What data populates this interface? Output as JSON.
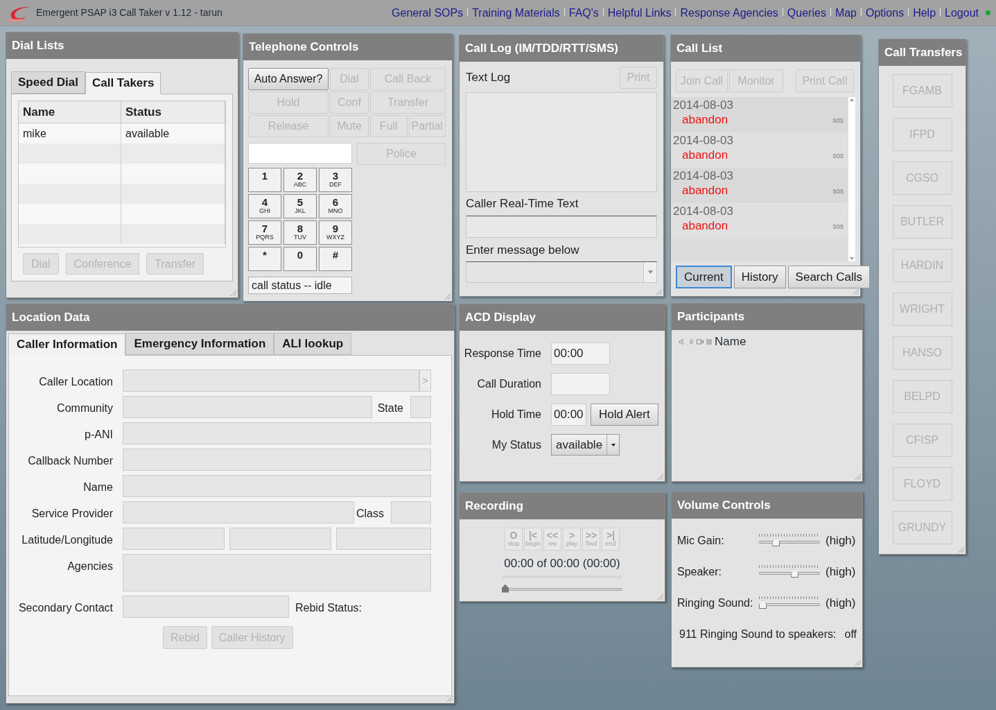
{
  "top_bar": {
    "title": "Emergent PSAP i3 Call Taker v 1.12 - tarun",
    "links": [
      "General SOPs",
      "Training Materials",
      "FAQ's",
      "Helpful Links",
      "Response Agencies",
      "Queries",
      "Map",
      "Options",
      "Help",
      "Logout"
    ],
    "connected": true
  },
  "dial_lists": {
    "title": "Dial Lists",
    "tabs": [
      {
        "label": "Speed Dial",
        "selected": false
      },
      {
        "label": "Call Takers",
        "selected": true
      }
    ],
    "columns": [
      "Name",
      "Status"
    ],
    "rows": [
      [
        "mike",
        "available"
      ]
    ],
    "buttons": [
      {
        "label": "Dial",
        "disabled": true
      },
      {
        "label": "Conference",
        "disabled": true
      },
      {
        "label": "Transfer",
        "disabled": true
      }
    ]
  },
  "telephone_controls": {
    "title": "Telephone Controls",
    "button_rows": [
      [
        {
          "label": "Auto Answer?",
          "disabled": false
        },
        {
          "label": "Dial",
          "disabled": true
        },
        {
          "label": "Call Back",
          "disabled": true
        }
      ],
      [
        {
          "label": "Hold",
          "disabled": true
        },
        {
          "label": "Conf",
          "disabled": true
        },
        {
          "label": "Transfer",
          "disabled": true
        }
      ],
      [
        {
          "label": "Release",
          "disabled": true
        },
        {
          "label": "Mute",
          "disabled": true
        },
        {
          "label": "Full",
          "disabled": true
        },
        {
          "label": "Partial",
          "disabled": true
        }
      ]
    ],
    "police_button": {
      "label": "Police",
      "disabled": true
    },
    "keypad": [
      {
        "digit": "1"
      },
      {
        "digit": "2",
        "letters": "ABC"
      },
      {
        "digit": "3",
        "letters": "DEF"
      },
      {
        "digit": "4",
        "letters": "GHI"
      },
      {
        "digit": "5",
        "letters": "JKL"
      },
      {
        "digit": "6",
        "letters": "MNO"
      },
      {
        "digit": "7",
        "letters": "PQRS"
      },
      {
        "digit": "8",
        "letters": "TUV"
      },
      {
        "digit": "9",
        "letters": "WXYZ"
      },
      {
        "digit": "*"
      },
      {
        "digit": "0"
      },
      {
        "digit": "#"
      }
    ],
    "call_status": "call status -- idle"
  },
  "call_log": {
    "title": "Call Log (IM/TDD/RTT/SMS)",
    "text_log_label": "Text Log",
    "print_button": {
      "label": "Print",
      "disabled": true
    },
    "rtt_label": "Caller Real-Time Text",
    "message_label": "Enter message below"
  },
  "call_list": {
    "title": "Call List",
    "buttons": [
      {
        "label": "Join Call",
        "disabled": true
      },
      {
        "label": "Monitor",
        "disabled": true
      },
      {
        "label": "Print Call",
        "disabled": true
      }
    ],
    "calls": [
      {
        "date": "2014-08-03",
        "status": "abandon",
        "tag": "sos"
      },
      {
        "date": "2014-08-03",
        "status": "abandon",
        "tag": "sos"
      },
      {
        "date": "2014-08-03",
        "status": "abandon",
        "tag": "sos"
      },
      {
        "date": "2014-08-03",
        "status": "abandon",
        "tag": "sos"
      }
    ],
    "views": [
      {
        "label": "Current",
        "selected": true
      },
      {
        "label": "History",
        "selected": false
      },
      {
        "label": "Search Calls",
        "selected": false
      }
    ]
  },
  "call_transfers": {
    "title": "Call Transfers",
    "buttons": [
      "FGAMB",
      "IFPD",
      "CGSO",
      "BUTLER",
      "HARDIN",
      "WRIGHT",
      "HANSO",
      "BELPD",
      "CFISP",
      "FLOYD",
      "GRUNDY"
    ]
  },
  "location_data": {
    "title": "Location Data",
    "tabs": [
      {
        "label": "Caller Information",
        "selected": true
      },
      {
        "label": "Emergency Information",
        "selected": false
      },
      {
        "label": "ALI lookup",
        "selected": false
      }
    ],
    "fields": [
      {
        "label": "Caller Location",
        "kind": "with_button",
        "button": ">"
      },
      {
        "label": "Community",
        "kind": "with_extra",
        "extra_label": "State"
      },
      {
        "label": "p-ANI",
        "kind": "text"
      },
      {
        "label": "Callback Number",
        "kind": "text"
      },
      {
        "label": "Name",
        "kind": "text"
      },
      {
        "label": "Service Provider",
        "kind": "with_extra",
        "extra_label": "Class"
      },
      {
        "label": "Latitude/Longitude",
        "kind": "triple"
      },
      {
        "label": "Agencies",
        "kind": "tall"
      },
      {
        "label": "Secondary Contact",
        "kind": "with_note",
        "note": "Rebid Status:"
      }
    ],
    "buttons": [
      {
        "label": "Rebid",
        "disabled": true
      },
      {
        "label": "Caller History",
        "disabled": true
      }
    ]
  },
  "acd_display": {
    "title": "ACD Display",
    "rows": [
      {
        "label": "Response Time",
        "kind": "value",
        "value": "00:00"
      },
      {
        "label": "Call Duration",
        "kind": "value"
      },
      {
        "label": "Hold Time",
        "kind": "value_button",
        "value": "00:00",
        "button": "Hold Alert"
      },
      {
        "label": "My Status",
        "kind": "select",
        "value": "available"
      }
    ]
  },
  "participants": {
    "title": "Participants",
    "column": "Name"
  },
  "recording": {
    "title": "Recording",
    "buttons": [
      {
        "symbol": "O",
        "label": "stop"
      },
      {
        "symbol": "|<",
        "label": "begin"
      },
      {
        "symbol": "<<",
        "label": "rev"
      },
      {
        "symbol": ">",
        "label": "play"
      },
      {
        "symbol": ">>",
        "label": "ffwd"
      },
      {
        "symbol": ">|",
        "label": "end"
      }
    ],
    "time": "00:00 of 00:00 (00:00)",
    "level": 0
  },
  "volume_controls": {
    "title": "Volume Controls",
    "sliders": [
      {
        "label": "Mic Gain:",
        "level": 0.25,
        "reading": "(high)"
      },
      {
        "label": "Speaker:",
        "level": 0.6,
        "reading": "(high)"
      },
      {
        "label": "Ringing Sound:",
        "level": 0,
        "reading": "(high)"
      }
    ],
    "ringing_label": "911 Ringing Sound to speakers:",
    "ringing_value": "off"
  }
}
